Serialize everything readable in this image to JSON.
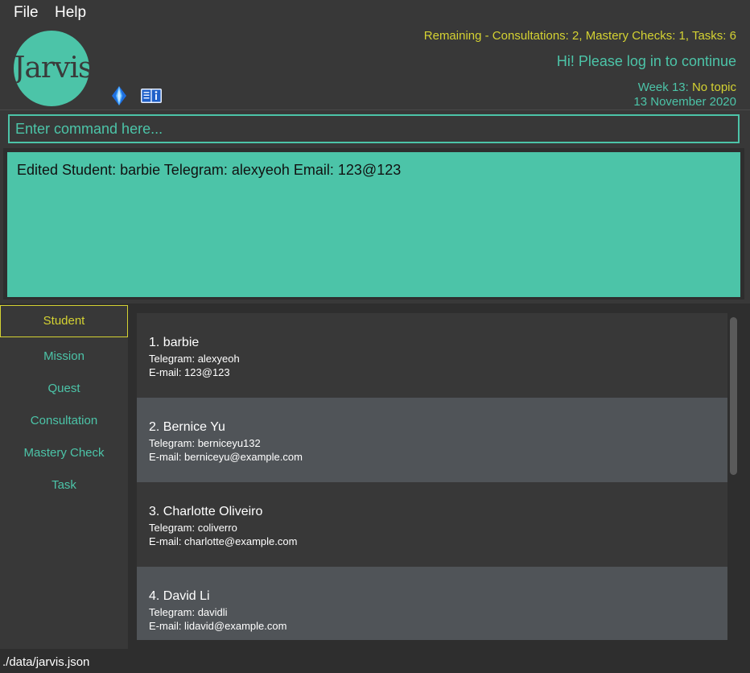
{
  "menu": {
    "file": "File",
    "help": "Help"
  },
  "header": {
    "logo_text": "Jarvis",
    "logo_dot": ".",
    "remaining": "Remaining - Consultations: 2, Mastery Checks: 1, Tasks: 6",
    "greeting": "Hi! Please log in to continue",
    "week_label": "Week 13: ",
    "week_topic": "No topic",
    "date": "13 November 2020",
    "icons": [
      "diamond-icon",
      "book-info-icon"
    ]
  },
  "command": {
    "placeholder": "Enter command here...",
    "value": ""
  },
  "result": {
    "text": "Edited Student: barbie Telegram: alexyeoh Email: 123@123"
  },
  "sidebar": {
    "items": [
      {
        "label": "Student",
        "active": true
      },
      {
        "label": "Mission",
        "active": false
      },
      {
        "label": "Quest",
        "active": false
      },
      {
        "label": "Consultation",
        "active": false
      },
      {
        "label": "Mastery Check",
        "active": false
      },
      {
        "label": "Task",
        "active": false
      }
    ]
  },
  "students": [
    {
      "name": "1.  barbie",
      "telegram": "Telegram: alexyeoh",
      "email": "E-mail: 123@123"
    },
    {
      "name": "2.  Bernice Yu",
      "telegram": "Telegram: berniceyu132",
      "email": "E-mail: berniceyu@example.com"
    },
    {
      "name": "3.  Charlotte Oliveiro",
      "telegram": "Telegram: coliverro",
      "email": "E-mail: charlotte@example.com"
    },
    {
      "name": "4.  David Li",
      "telegram": "Telegram: davidli",
      "email": "E-mail: lidavid@example.com"
    }
  ],
  "status": {
    "path": "./data/jarvis.json"
  },
  "colors": {
    "accent": "#4cc4a8",
    "highlight": "#d4d232",
    "background": "#383838",
    "card_alt": "#505458"
  }
}
